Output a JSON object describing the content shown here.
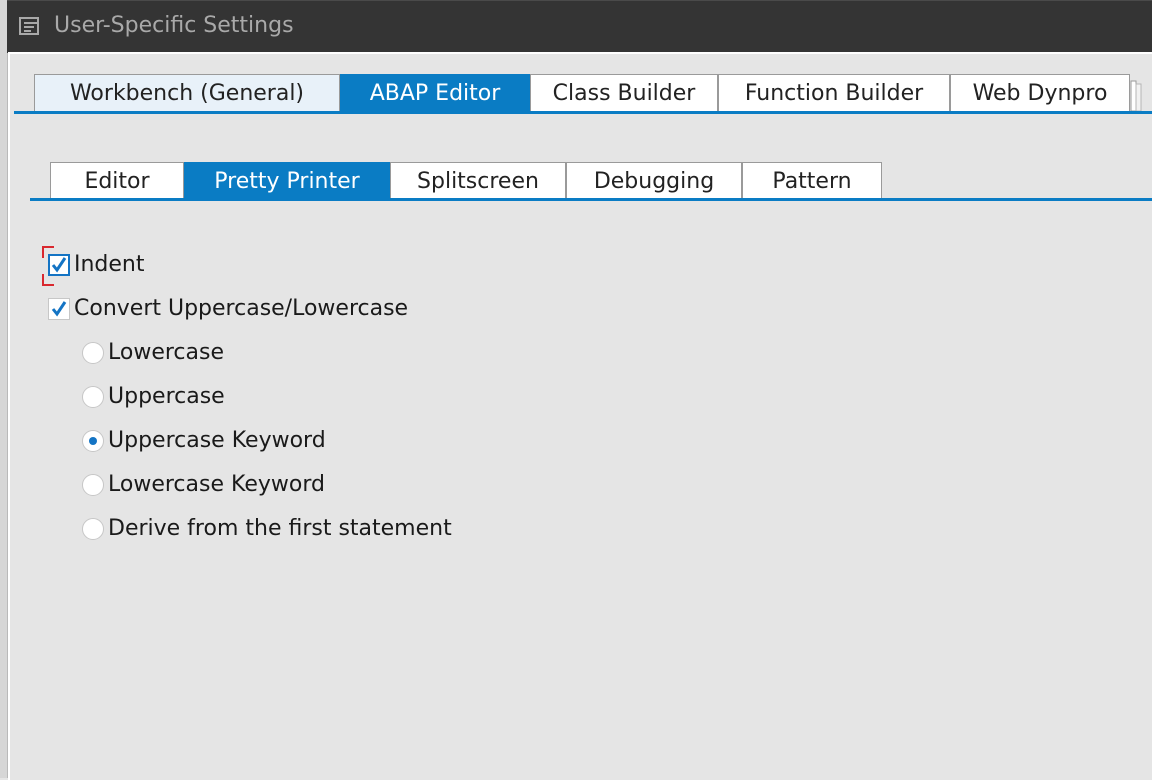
{
  "window": {
    "title": "User-Specific Settings"
  },
  "main_tabs": [
    {
      "label": "Workbench (General)",
      "state": "inactive"
    },
    {
      "label": "ABAP Editor",
      "state": "active"
    },
    {
      "label": "Class Builder",
      "state": "inactive"
    },
    {
      "label": "Function Builder",
      "state": "inactive"
    },
    {
      "label": "Web Dynpro",
      "state": "inactive"
    }
  ],
  "sub_tabs": [
    {
      "label": "Editor",
      "state": "inactive"
    },
    {
      "label": "Pretty Printer",
      "state": "active"
    },
    {
      "label": "Splitscreen",
      "state": "inactive"
    },
    {
      "label": "Debugging",
      "state": "inactive"
    },
    {
      "label": "Pattern",
      "state": "inactive"
    }
  ],
  "options": {
    "indent": {
      "label": "Indent",
      "checked": true,
      "focused": true
    },
    "convert_case": {
      "label": "Convert Uppercase/Lowercase",
      "checked": true
    },
    "case_mode": {
      "selected": "Uppercase Keyword",
      "choices": [
        {
          "label": "Lowercase",
          "selected": false
        },
        {
          "label": "Uppercase",
          "selected": false
        },
        {
          "label": "Uppercase Keyword",
          "selected": true
        },
        {
          "label": "Lowercase Keyword",
          "selected": false
        },
        {
          "label": "Derive from the first statement",
          "selected": false
        }
      ]
    }
  },
  "colors": {
    "accent": "#0a7cc4",
    "titlebar": "#343434",
    "background": "#e5e5e5",
    "focus_bracket": "#d9282f"
  },
  "icons": {
    "title": "window-menu-icon",
    "check": "checkmark-icon",
    "radio_dot": "radio-dot-icon",
    "overflow": "tab-overflow-icon"
  }
}
